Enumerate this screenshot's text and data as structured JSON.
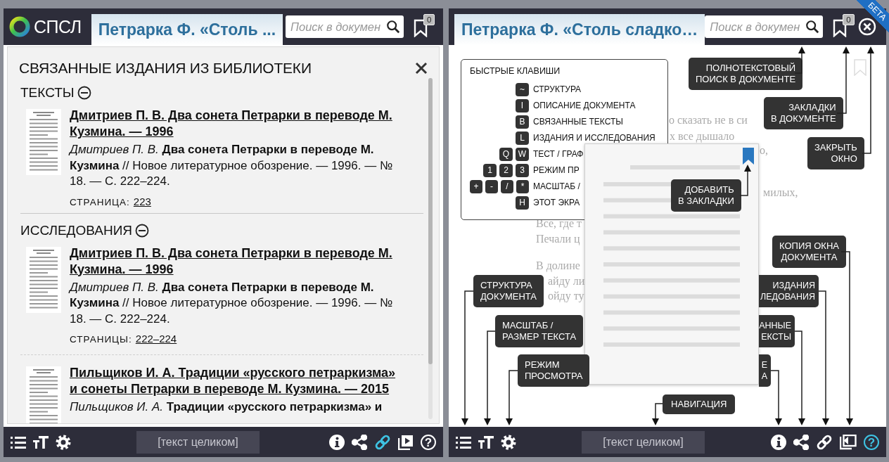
{
  "left_window": {
    "logo": "СПСЛ",
    "tab": {
      "label": "Петрарка Ф. «Столь ...",
      "selected": true
    },
    "search": {
      "placeholder": "Поиск в докумен"
    },
    "bookmark_count": "0",
    "related": {
      "title": "СВЯЗАННЫЕ ИЗДАНИЯ ИЗ БИБЛИОТЕКИ",
      "sections": [
        {
          "heading": "ТЕКСТЫ",
          "expanded": true,
          "entries": [
            {
              "title": "Дмитриев П. В. Два сонета Петрарки в переводе М. Кузмина. — 1996",
              "citation": "*Дмитриев П. В.* **Два сонета Петрарки в переводе М. Кузмина** // Новое литературное обозрение. — 1996. — № 18. — С. 222–224.",
              "pages_label": "СТРАНИЦА:",
              "pages": "223"
            }
          ]
        },
        {
          "heading": "ИССЛЕДОВАНИЯ",
          "expanded": true,
          "entries": [
            {
              "title": "Дмитриев П. В. Два сонета Петрарки в переводе М. Кузмина. — 1996",
              "citation": "*Дмитриев П. В.* **Два сонета Петрарки в переводе М. Кузмина** // Новое литературное обозрение. — 1996. — № 18. — С. 222–224.",
              "pages_label": "СТРАНИЦЫ:",
              "pages": "222–224"
            },
            {
              "title": "Пильщиков И. А. Традиции «русского петраркизма» и сонеты Петрарки в переводе М. Кузмина. — 2015",
              "citation": "*Пильщиков И. А.* **Традиции «русского петраркизма» и**"
            }
          ]
        }
      ]
    },
    "toolbar": {
      "tools_left": [
        {
          "kind": "list"
        },
        {
          "kind": "text-size"
        },
        {
          "kind": "settings"
        }
      ],
      "center_button": "[текст целиком]",
      "tools_right": [
        {
          "kind": "info",
          "active": false
        },
        {
          "kind": "share",
          "active": false
        },
        {
          "kind": "link",
          "active": true
        },
        {
          "kind": "play",
          "active": false
        },
        {
          "kind": "help",
          "glyph": "?",
          "active": false
        }
      ]
    }
  },
  "right_window": {
    "tab": {
      "label": "Петрарка Ф. «Столь сладко…",
      "selected": true
    },
    "search": {
      "placeholder": "Поиск в докумен"
    },
    "bookmark_count": "0",
    "beta": "БЕТА",
    "document_fragments": [
      "о сказать не в си",
      "х все дышало",
      "о,",
      "милых,",
      "Все, где т",
      "Печали ц",
      "В долине",
      "айду ли",
      "ойду ту"
    ],
    "shortcuts": {
      "title": "БЫСТРЫЕ КЛАВИШИ",
      "items": [
        {
          "keys": [
            "~"
          ],
          "label": "СТРУКТУРА"
        },
        {
          "keys": [
            "I"
          ],
          "label": "ОПИСАНИЕ ДОКУМЕНТА"
        },
        {
          "keys": [
            "B"
          ],
          "label": "СВЯЗАННЫЕ ТЕКСТЫ"
        },
        {
          "keys": [
            "L"
          ],
          "label": "ИЗДАНИЯ И ИССЛЕДОВАНИЯ"
        },
        {
          "keys": [
            "Q",
            "W"
          ],
          "label": "ТЕСТ / ГРАФ"
        },
        {
          "keys": [
            "1",
            "2",
            "3"
          ],
          "label": "РЕЖИМ ПР"
        },
        {
          "keys": [
            "+",
            "-",
            "/",
            "*"
          ],
          "label": "МАСШТАБ /"
        },
        {
          "keys": [
            "H"
          ],
          "label": "ЭТОТ ЭКРА"
        }
      ]
    },
    "preview": {
      "bookmarked": true
    },
    "callouts": [
      {
        "text": "ПОЛНОТЕКСТОВЫЙ\nПОИСК В ДОКУМЕНТЕ"
      },
      {
        "text": "ЗАКЛАДКИ\nВ ДОКУМЕНТЕ"
      },
      {
        "text": "ЗАКРЫТЬ\nОКНО"
      },
      {
        "text": "ДОБАВИТЬ\nВ ЗАКЛАДКИ"
      },
      {
        "text": "КОПИЯ ОКНА\nДОКУМЕНТА"
      },
      {
        "text": "ИЗДАНИЯ\nЛЕДОВАНИЯ"
      },
      {
        "text": "АННЫЕ\nЕКСТЫ"
      },
      {
        "text": "Е\nА"
      },
      {
        "text": "НАВИГАЦИЯ"
      },
      {
        "text": "СТРУКТУРА\nДОКУМЕНТА"
      },
      {
        "text": "МАСШТАБ /\nРАЗМЕР ТЕКСТА"
      },
      {
        "text": "РЕЖИМ\nПРОСМОТРА"
      }
    ],
    "toolbar": {
      "tools_left": [
        {
          "kind": "list"
        },
        {
          "kind": "text-size"
        },
        {
          "kind": "settings"
        }
      ],
      "center_button": "[текст целиком]",
      "tools_right": [
        {
          "kind": "info",
          "active": false
        },
        {
          "kind": "share",
          "active": false
        },
        {
          "kind": "link",
          "active": false
        },
        {
          "kind": "copy-window",
          "active": false
        },
        {
          "kind": "help",
          "glyph": "?",
          "active": true
        }
      ]
    }
  }
}
